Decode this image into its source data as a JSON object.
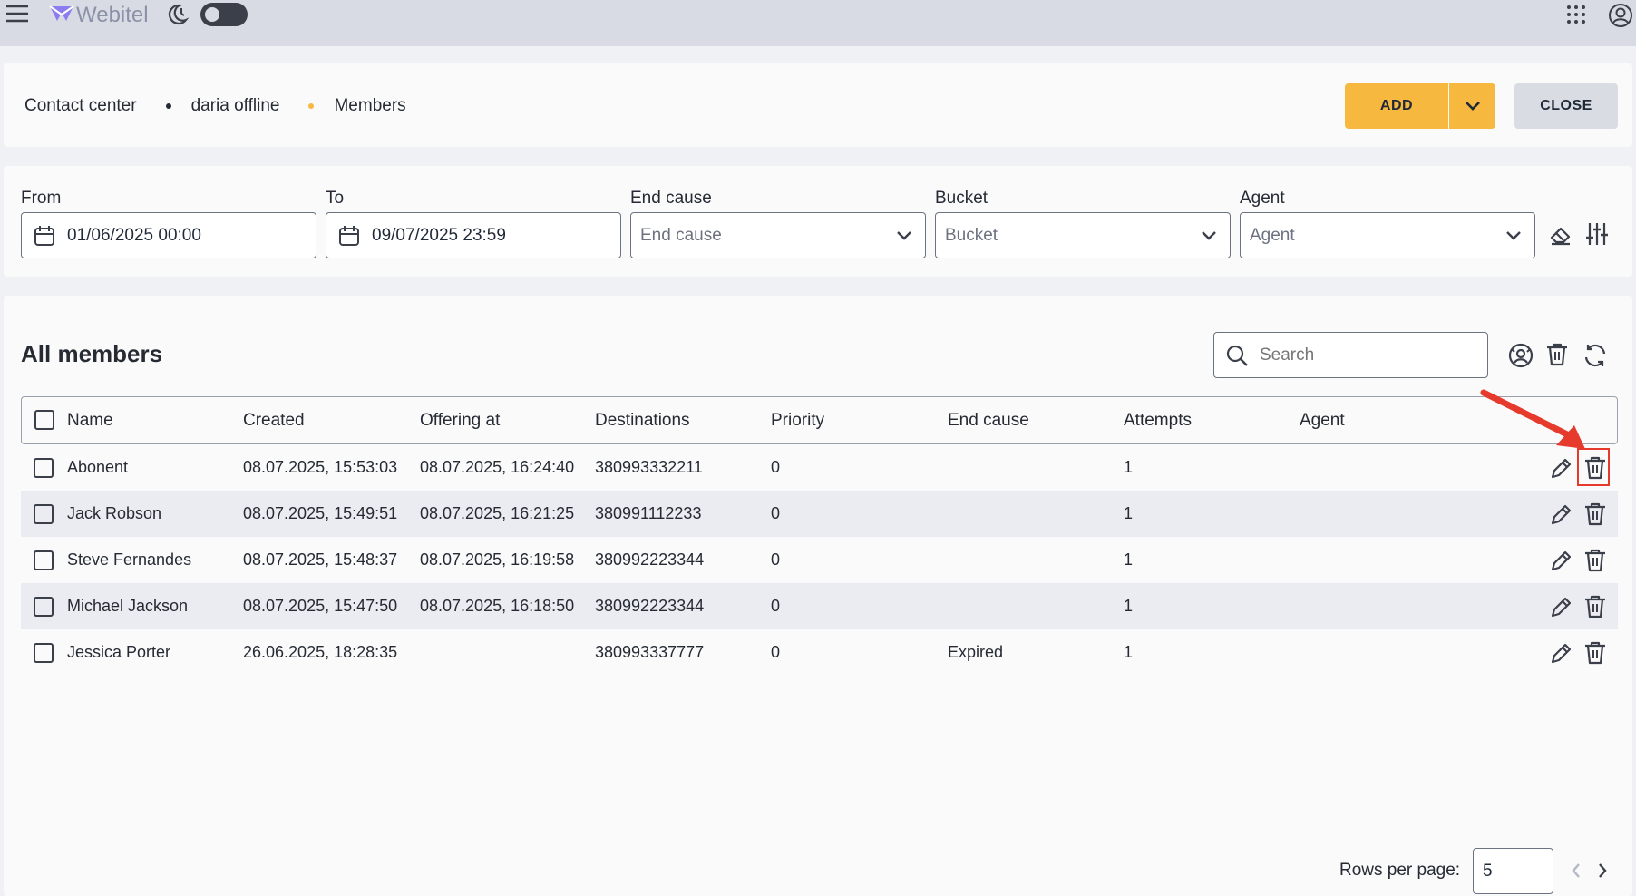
{
  "app": {
    "name": "Webitel"
  },
  "breadcrumb": [
    "Contact center",
    "daria offline",
    "Members"
  ],
  "header_actions": {
    "add_label": "ADD",
    "close_label": "CLOSE"
  },
  "filters": {
    "from": {
      "label": "From",
      "value": "01/06/2025 00:00"
    },
    "to": {
      "label": "To",
      "value": "09/07/2025 23:59"
    },
    "end_cause": {
      "label": "End cause",
      "placeholder": "End cause"
    },
    "bucket": {
      "label": "Bucket",
      "placeholder": "Bucket"
    },
    "agent": {
      "label": "Agent",
      "placeholder": "Agent"
    }
  },
  "members": {
    "title": "All members",
    "search_placeholder": "Search",
    "columns": [
      "Name",
      "Created",
      "Offering at",
      "Destinations",
      "Priority",
      "End cause",
      "Attempts",
      "Agent"
    ],
    "rows": [
      {
        "name": "Abonent",
        "created": "08.07.2025, 15:53:03",
        "offering_at": "08.07.2025, 16:24:40",
        "destinations": "380993332211",
        "priority": "0",
        "end_cause": "",
        "attempts": "1",
        "agent": ""
      },
      {
        "name": "Jack Robson",
        "created": "08.07.2025, 15:49:51",
        "offering_at": "08.07.2025, 16:21:25",
        "destinations": "380991112233",
        "priority": "0",
        "end_cause": "",
        "attempts": "1",
        "agent": ""
      },
      {
        "name": "Steve Fernandes",
        "created": "08.07.2025, 15:48:37",
        "offering_at": "08.07.2025, 16:19:58",
        "destinations": "380992223344",
        "priority": "0",
        "end_cause": "",
        "attempts": "1",
        "agent": ""
      },
      {
        "name": "Michael Jackson",
        "created": "08.07.2025, 15:47:50",
        "offering_at": "08.07.2025, 16:18:50",
        "destinations": "380992223344",
        "priority": "0",
        "end_cause": "",
        "attempts": "1",
        "agent": ""
      },
      {
        "name": "Jessica Porter",
        "created": "26.06.2025, 18:28:35",
        "offering_at": "",
        "destinations": "380993337777",
        "priority": "0",
        "end_cause": "Expired",
        "attempts": "1",
        "agent": ""
      }
    ]
  },
  "pagination": {
    "rows_per_page_label": "Rows per page:",
    "rows_per_page_value": "5"
  },
  "colors": {
    "accent": "#f6b83f",
    "highlight": "#e53a2c",
    "brand": "#7b68ee"
  },
  "icons": [
    "menu-icon",
    "webitel-logo-icon",
    "phone-moon-icon",
    "apps-grid-icon",
    "account-icon",
    "chevron-down-icon",
    "calendar-icon",
    "eraser-icon",
    "filter-settings-icon",
    "search-icon",
    "user-circle-icon",
    "trash-icon",
    "refresh-icon",
    "pencil-icon",
    "chevron-left-icon",
    "chevron-right-icon"
  ]
}
